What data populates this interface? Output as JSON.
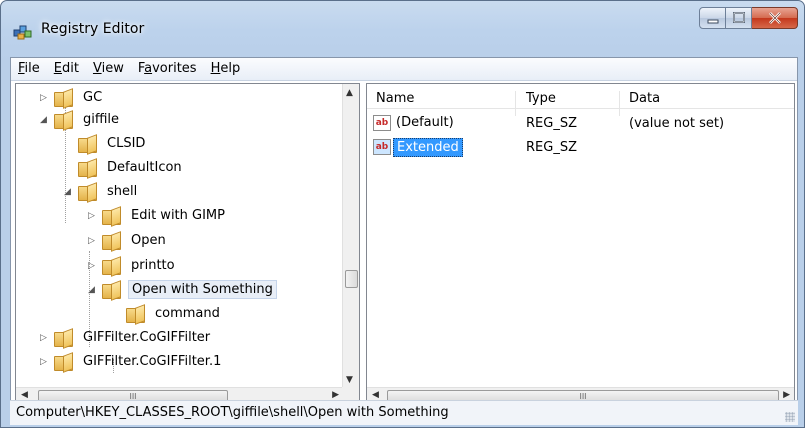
{
  "window": {
    "title": "Registry Editor"
  },
  "menu": [
    {
      "label": "File",
      "accel": "F",
      "rest": "ile"
    },
    {
      "label": "Edit",
      "accel": "E",
      "rest": "dit"
    },
    {
      "label": "View",
      "accel": "V",
      "rest": "iew"
    },
    {
      "label": "Favorites",
      "accel": "a",
      "pre": "F",
      "rest": "vorites"
    },
    {
      "label": "Help",
      "accel": "H",
      "rest": "elp"
    }
  ],
  "tree": {
    "items": [
      {
        "label": "GC"
      },
      {
        "label": "giffile"
      },
      {
        "label": "CLSID"
      },
      {
        "label": "DefaultIcon"
      },
      {
        "label": "shell"
      },
      {
        "label": "Edit with GIMP"
      },
      {
        "label": "Open"
      },
      {
        "label": "printto"
      },
      {
        "label": "Open with Something"
      },
      {
        "label": "command"
      },
      {
        "label": "GIFFilter.CoGIFFilter"
      },
      {
        "label": "GIFFilter.CoGIFFilter.1"
      }
    ]
  },
  "list": {
    "columns": [
      "Name",
      "Type",
      "Data"
    ],
    "rows": [
      {
        "name": "(Default)",
        "type": "REG_SZ",
        "data": "(value not set)",
        "icon": "ab"
      },
      {
        "name": "Extended",
        "type": "REG_SZ",
        "data": "",
        "icon": "ab"
      }
    ]
  },
  "status": {
    "path": "Computer\\HKEY_CLASSES_ROOT\\giffile\\shell\\Open with Something"
  },
  "colors": {
    "selection": "#3399ff",
    "frame": "#bcd2ec",
    "close": "#c4371c"
  }
}
